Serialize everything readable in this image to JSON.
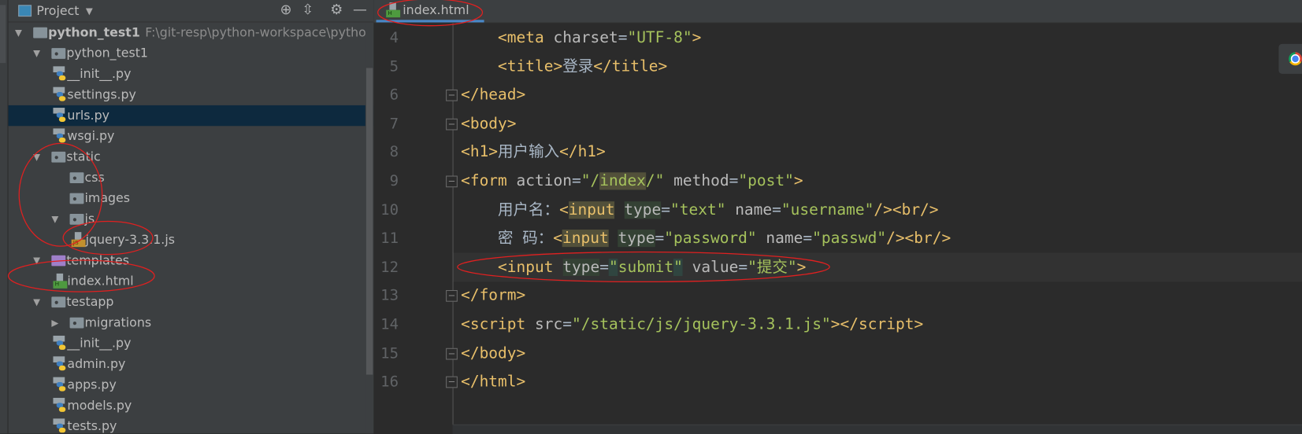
{
  "sidebar": {
    "title": "Project",
    "tree": [
      {
        "label": "python_test1",
        "path": "F:\\git-resp\\python-workspace\\python_test",
        "depth": 0,
        "kind": "folder-plain",
        "arrow": "down",
        "bold": true
      },
      {
        "label": "python_test1",
        "depth": 1,
        "kind": "folder",
        "arrow": "down"
      },
      {
        "label": "__init__.py",
        "depth": 2,
        "kind": "py"
      },
      {
        "label": "settings.py",
        "depth": 2,
        "kind": "py"
      },
      {
        "label": "urls.py",
        "depth": 2,
        "kind": "py",
        "selected": true
      },
      {
        "label": "wsgi.py",
        "depth": 2,
        "kind": "py"
      },
      {
        "label": "static",
        "depth": 1,
        "kind": "folder",
        "arrow": "down"
      },
      {
        "label": "css",
        "depth": 2,
        "kind": "folder"
      },
      {
        "label": "images",
        "depth": 2,
        "kind": "folder"
      },
      {
        "label": "js",
        "depth": 2,
        "kind": "folder",
        "arrow": "down"
      },
      {
        "label": "jquery-3.3.1.js",
        "depth": 3,
        "kind": "js"
      },
      {
        "label": "templates",
        "depth": 1,
        "kind": "folder-purple",
        "arrow": "down"
      },
      {
        "label": "index.html",
        "depth": 2,
        "kind": "html"
      },
      {
        "label": "testapp",
        "depth": 1,
        "kind": "folder",
        "arrow": "down"
      },
      {
        "label": "migrations",
        "depth": 2,
        "kind": "folder",
        "arrow": "right"
      },
      {
        "label": "__init__.py",
        "depth": 2,
        "kind": "py"
      },
      {
        "label": "admin.py",
        "depth": 2,
        "kind": "py"
      },
      {
        "label": "apps.py",
        "depth": 2,
        "kind": "py"
      },
      {
        "label": "models.py",
        "depth": 2,
        "kind": "py"
      },
      {
        "label": "tests.py",
        "depth": 2,
        "kind": "py"
      }
    ]
  },
  "editor": {
    "tab_label": "index.html",
    "current_line": 12,
    "lines": [
      {
        "n": "4",
        "fold": false,
        "tokens": [
          [
            "txt2",
            "    "
          ],
          [
            "tag",
            "<meta "
          ],
          [
            "att",
            "charset"
          ],
          [
            "txt2",
            "="
          ],
          [
            "str",
            "\"UTF-8\""
          ],
          [
            "tag",
            ">"
          ]
        ]
      },
      {
        "n": "5",
        "fold": false,
        "tokens": [
          [
            "txt2",
            "    "
          ],
          [
            "tag",
            "<title>"
          ],
          [
            "txt2",
            "登录"
          ],
          [
            "tag",
            "</title>"
          ]
        ]
      },
      {
        "n": "6",
        "fold": true,
        "tokens": [
          [
            "tag",
            "</head>"
          ]
        ]
      },
      {
        "n": "7",
        "fold": true,
        "tokens": [
          [
            "tag",
            "<body>"
          ]
        ]
      },
      {
        "n": "8",
        "fold": false,
        "tokens": [
          [
            "tag",
            "<h1>"
          ],
          [
            "txt2",
            "用户输入"
          ],
          [
            "tag",
            "</h1>"
          ]
        ]
      },
      {
        "n": "9",
        "fold": true,
        "tokens": [
          [
            "tag",
            "<form "
          ],
          [
            "att",
            "action"
          ],
          [
            "txt2",
            "="
          ],
          [
            "str",
            "\"/"
          ],
          [
            "str hl1",
            "index"
          ],
          [
            "str",
            "/\""
          ],
          [
            "att",
            " method"
          ],
          [
            "txt2",
            "="
          ],
          [
            "str",
            "\"post\""
          ],
          [
            "tag",
            ">"
          ]
        ]
      },
      {
        "n": "10",
        "fold": false,
        "tokens": [
          [
            "txt2",
            "    用户名："
          ],
          [
            "tag",
            "<"
          ],
          [
            "tag hl1",
            "input"
          ],
          [
            "tag",
            " "
          ],
          [
            "att hl2",
            "type"
          ],
          [
            "txt2",
            "="
          ],
          [
            "str",
            "\"text\""
          ],
          [
            "att",
            " name"
          ],
          [
            "txt2",
            "="
          ],
          [
            "str",
            "\"username\""
          ],
          [
            "tag",
            "/><br/>"
          ]
        ]
      },
      {
        "n": "11",
        "fold": false,
        "tokens": [
          [
            "txt2",
            "    密 码："
          ],
          [
            "tag",
            "<"
          ],
          [
            "tag hl1",
            "input"
          ],
          [
            "tag",
            " "
          ],
          [
            "att hl2",
            "type"
          ],
          [
            "txt2",
            "="
          ],
          [
            "str",
            "\"password\""
          ],
          [
            "att",
            " name"
          ],
          [
            "txt2",
            "="
          ],
          [
            "str",
            "\"passwd\""
          ],
          [
            "tag",
            "/><br/>"
          ]
        ]
      },
      {
        "n": "12",
        "fold": false,
        "tokens": [
          [
            "txt2",
            "    "
          ],
          [
            "tag",
            "<input "
          ],
          [
            "att hl2",
            "type"
          ],
          [
            "txt2",
            "="
          ],
          [
            "str hl3",
            "\""
          ],
          [
            "str",
            "submit"
          ],
          [
            "str hl3",
            "\""
          ],
          [
            "att",
            " value"
          ],
          [
            "txt2",
            "="
          ],
          [
            "str",
            "\"提交\""
          ],
          [
            "tag",
            ">"
          ]
        ]
      },
      {
        "n": "13",
        "fold": true,
        "tokens": [
          [
            "tag",
            "</form>"
          ]
        ]
      },
      {
        "n": "14",
        "fold": false,
        "tokens": [
          [
            "tag",
            "<script "
          ],
          [
            "att",
            "src"
          ],
          [
            "txt2",
            "="
          ],
          [
            "str",
            "\"/static/js/jquery-3.3.1.js\""
          ],
          [
            "tag",
            "></script>"
          ]
        ]
      },
      {
        "n": "15",
        "fold": true,
        "tokens": [
          [
            "tag",
            "</body>"
          ]
        ]
      },
      {
        "n": "16",
        "fold": true,
        "tokens": [
          [
            "tag",
            "</html>"
          ]
        ]
      }
    ]
  },
  "annotation_color": "#e02020",
  "icons": [
    "project-view-icon",
    "locate-icon",
    "collapse-all-icon",
    "gear-icon",
    "minimize-icon",
    "chrome-icon"
  ]
}
